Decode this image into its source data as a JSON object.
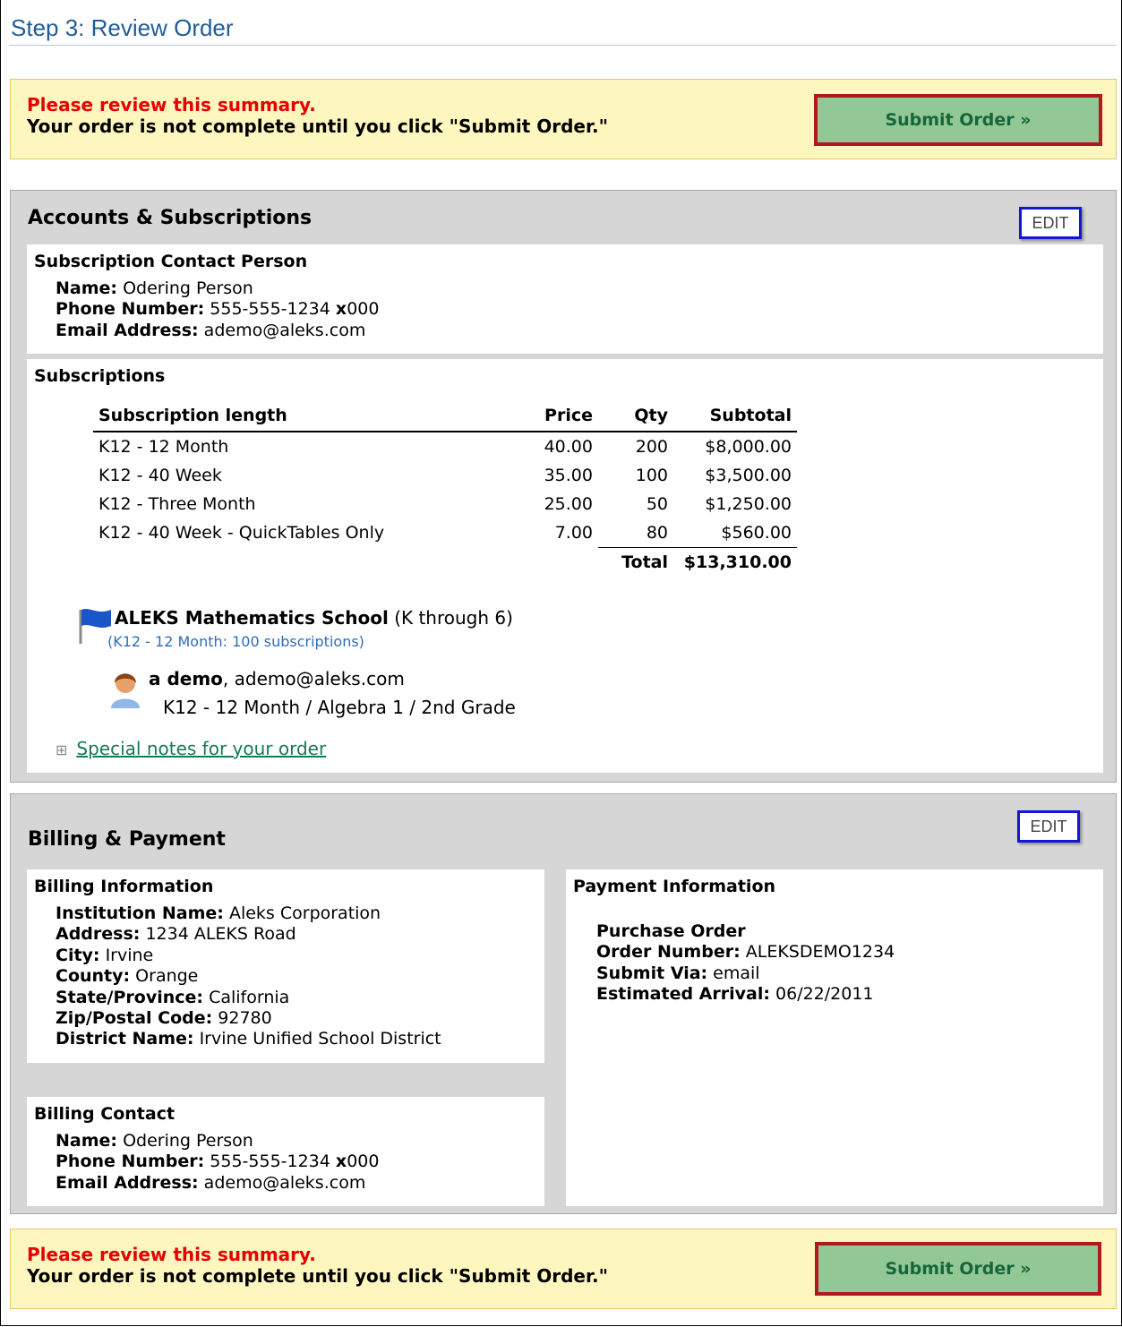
{
  "step_title": "Step 3: Review Order",
  "notice": {
    "line1": "Please review this summary.",
    "line2": "Your order is not complete until you click \"Submit Order.\"",
    "submit_label": "Submit Order »"
  },
  "accounts": {
    "title": "Accounts & Subscriptions",
    "edit_label": "EDIT",
    "contact": {
      "heading": "Subscription Contact Person",
      "name_label": "Name:",
      "name_value": "Odering Person",
      "phone_label": "Phone Number:",
      "phone_value": "555-555-1234",
      "phone_ext_label": "x",
      "phone_ext_value": "000",
      "email_label": "Email Address:",
      "email_value": "ademo@aleks.com"
    },
    "subscriptions": {
      "heading": "Subscriptions",
      "columns": [
        "Subscription length",
        "Price",
        "Qty",
        "Subtotal"
      ],
      "rows": [
        [
          "K12 - 12 Month",
          "40.00",
          "200",
          "$8,000.00"
        ],
        [
          "K12 - 40 Week",
          "35.00",
          "100",
          "$3,500.00"
        ],
        [
          "K12 - Three Month",
          "25.00",
          "50",
          "$1,250.00"
        ],
        [
          "K12 - 40 Week - QuickTables Only",
          "7.00",
          "80",
          "$560.00"
        ]
      ],
      "total_label": "Total",
      "total_value": "$13,310.00"
    },
    "school": {
      "name": "ALEKS Mathematics School",
      "grades": "(K through 6)",
      "detail": "(K12 - 12 Month: 100 subscriptions)"
    },
    "user": {
      "name": "a demo",
      "email": ", ademo@aleks.com",
      "detail": "K12 - 12 Month / Algebra 1 / 2nd Grade"
    },
    "notes_link": "Special notes for your order",
    "notes_toggle": "⊞"
  },
  "billing": {
    "title": "Billing & Payment",
    "edit_label": "EDIT",
    "info": {
      "heading": "Billing Information",
      "fields": [
        {
          "label": "Institution Name:",
          "value": "Aleks Corporation"
        },
        {
          "label": "Address:",
          "value": "1234 ALEKS Road"
        },
        {
          "label": "City:",
          "value": "Irvine"
        },
        {
          "label": "County:",
          "value": "Orange"
        },
        {
          "label": "State/Province:",
          "value": "California"
        },
        {
          "label": "Zip/Postal Code:",
          "value": "92780"
        },
        {
          "label": "District Name:",
          "value": "Irvine Unified School District"
        }
      ]
    },
    "contact": {
      "heading": "Billing Contact",
      "name_label": "Name:",
      "name_value": "Odering Person",
      "phone_label": "Phone Number:",
      "phone_value": "555-555-1234",
      "phone_ext_label": "x",
      "phone_ext_value": "000",
      "email_label": "Email Address:",
      "email_value": "ademo@aleks.com"
    },
    "payment": {
      "heading": "Payment Information",
      "method": "Purchase Order",
      "fields": [
        {
          "label": "Order Number:",
          "value": "ALEKSDEMO1234"
        },
        {
          "label": "Submit Via:",
          "value": "email"
        },
        {
          "label": "Estimated Arrival:",
          "value": "06/22/2011"
        }
      ]
    }
  },
  "colors": {
    "accent_red": "#e60000",
    "title_blue": "#1f5c99",
    "submit_bg": "#92c796",
    "submit_border": "#b0191e",
    "edit_border": "#1515d6",
    "link_green": "#167a53"
  },
  "icons": [
    "flag-icon",
    "user-icon",
    "expand-icon"
  ]
}
